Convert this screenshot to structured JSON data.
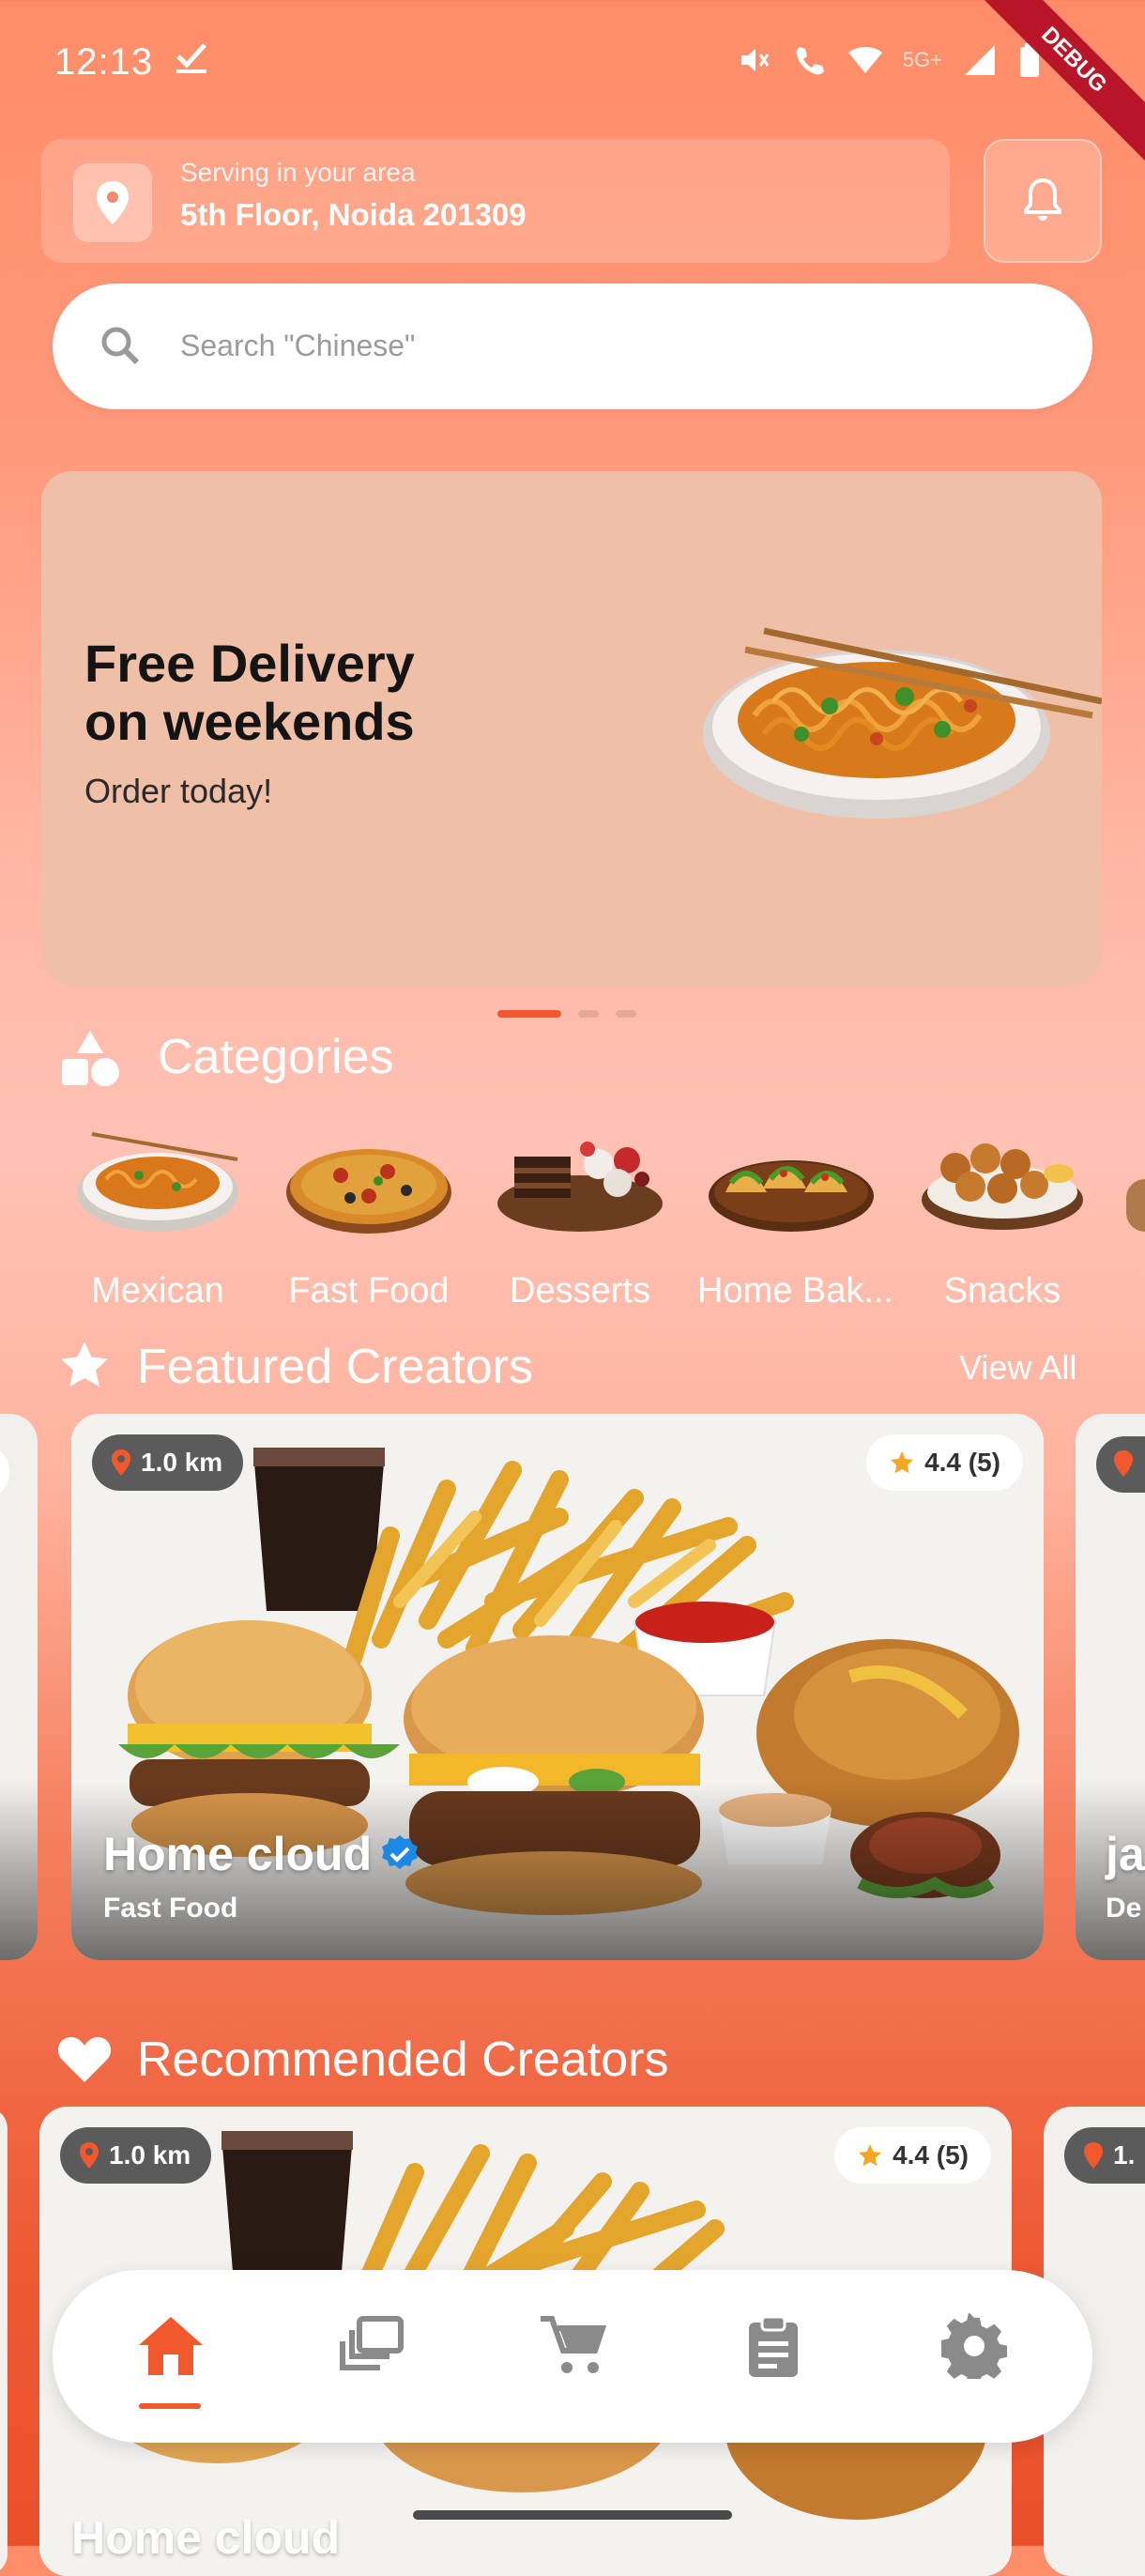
{
  "status_bar": {
    "time": "12:13",
    "network": "5G+",
    "debug": "DEBUG"
  },
  "location": {
    "caption": "Serving in your area",
    "address": "5th Floor, Noida 201309"
  },
  "search": {
    "placeholder": "Search \"Chinese\""
  },
  "banner": {
    "title_line1": "Free Delivery",
    "title_line2": "on weekends",
    "subtitle": "Order today!",
    "active_dot": 1,
    "dot_count": 3
  },
  "categories": {
    "title": "Categories",
    "items": [
      {
        "label": "Mexican",
        "image": "noodles-plate"
      },
      {
        "label": "Fast Food",
        "image": "pizza"
      },
      {
        "label": "Desserts",
        "image": "dessert-platter"
      },
      {
        "label": "Home Bak...",
        "image": "tacos"
      },
      {
        "label": "Snacks",
        "image": "fried-snacks"
      }
    ]
  },
  "featured": {
    "title": "Featured Creators",
    "view_all": "View All",
    "card": {
      "distance": "1.0 km",
      "rating": "4.4 (5)",
      "name": "Home cloud",
      "category": "Fast Food",
      "verified": true
    },
    "next_card": {
      "name_partial": "ja",
      "category_partial": "De"
    }
  },
  "recommended": {
    "title": "Recommended Creators",
    "card": {
      "distance": "1.0 km",
      "rating": "4.4 (5)",
      "name": "Home cloud"
    },
    "next_card": {
      "distance_partial": "1."
    }
  },
  "nav": {
    "items": [
      {
        "name": "home",
        "active": true
      },
      {
        "name": "collections",
        "active": false
      },
      {
        "name": "cart",
        "active": false
      },
      {
        "name": "orders",
        "active": false
      },
      {
        "name": "settings",
        "active": false
      }
    ]
  },
  "colors": {
    "accent": "#f1582d",
    "star": "#f5a623",
    "verified": "#1e88e5"
  }
}
